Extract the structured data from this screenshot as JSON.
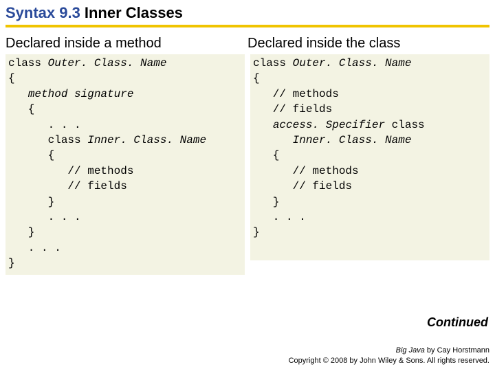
{
  "title": {
    "prefix": "Syntax 9.3",
    "main": "Inner Classes"
  },
  "left": {
    "heading": "Declared inside a method",
    "code": {
      "l1a": "class ",
      "l1b": "Outer. Class. Name",
      "l2": "{",
      "l3a": "   ",
      "l3b": "method signature",
      "l4": "   {",
      "l5": "      . . .",
      "l6a": "      class ",
      "l6b": "Inner. Class. Name",
      "l7": "      {",
      "l8": "         // methods",
      "l9": "         // fields",
      "l10": "      }",
      "l11": "      . . .",
      "l12": "   }",
      "l13": "   . . .",
      "l14": "}"
    }
  },
  "right": {
    "heading": "Declared inside the class",
    "code": {
      "l1a": "class ",
      "l1b": "Outer. Class. Name",
      "l2": "{",
      "l3": "   // methods",
      "l4": "   // fields",
      "l5a": "   ",
      "l5b": "access. Specifier ",
      "l5c": "class",
      "l6a": "      ",
      "l6b": "Inner. Class. Name",
      "l7": "   {",
      "l8": "      // methods",
      "l9": "      // fields",
      "l10": "   }",
      "l11": "   . . .",
      "l12": "}"
    }
  },
  "continued": "Continued",
  "footer": {
    "line1a": "Big Java",
    "line1b": " by Cay Horstmann",
    "line2": "Copyright © 2008 by John Wiley & Sons.  All rights reserved."
  }
}
